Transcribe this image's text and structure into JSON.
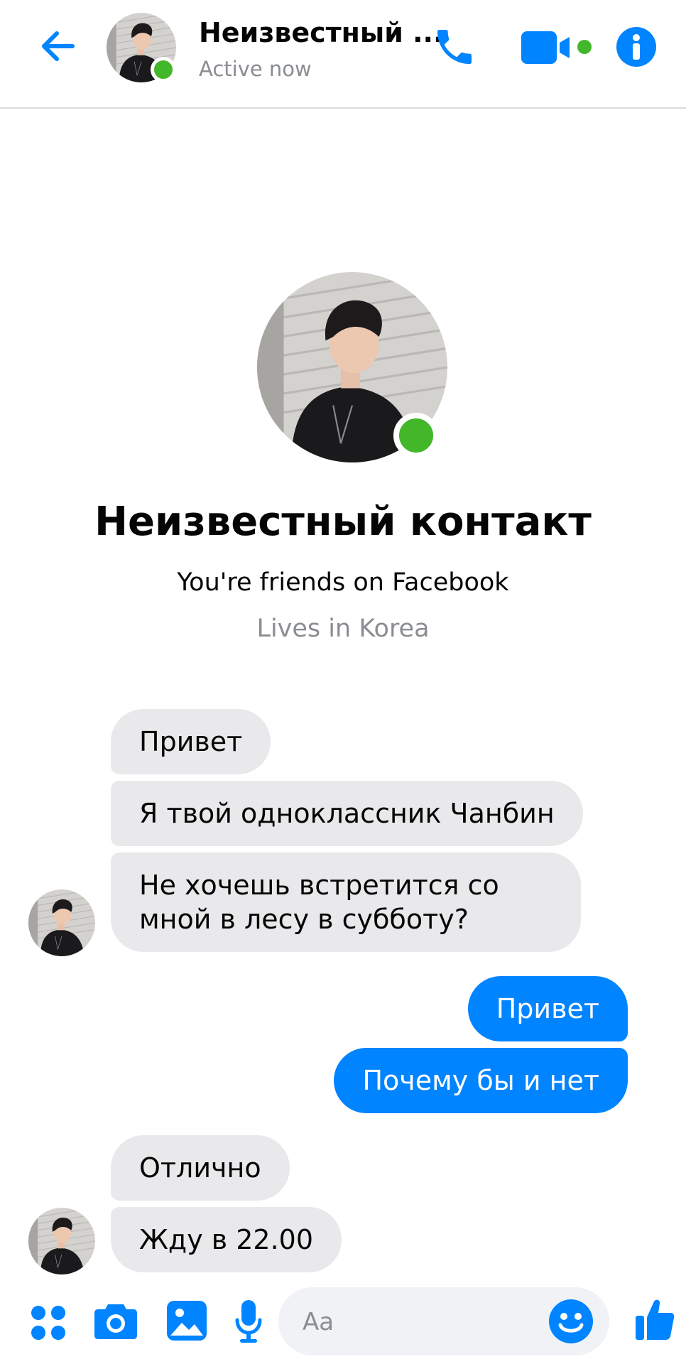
{
  "header": {
    "contact_name": "Неизвестный ...",
    "status": "Active now"
  },
  "profile": {
    "name": "Неизвестный контакт",
    "friendship": "You're friends on Facebook",
    "location": "Lives in Korea"
  },
  "messages": [
    {
      "from": "contact",
      "text": "Привет"
    },
    {
      "from": "contact",
      "text": "Я твой одноклассник Чанбин"
    },
    {
      "from": "contact",
      "text": "Не хочешь встретится со",
      "text2": "мной в лесу в субботу?"
    },
    {
      "from": "me",
      "text": "Привет"
    },
    {
      "from": "me",
      "text": "Почему бы и нет"
    },
    {
      "from": "contact",
      "text": "Отлично"
    },
    {
      "from": "contact",
      "text": "Жду в 22.00"
    }
  ],
  "composer": {
    "placeholder": "Aa"
  },
  "colors": {
    "accent": "#0084ff",
    "online": "#42b72a",
    "incoming_bubble": "#e9e9eb",
    "muted_text": "#8a8d91"
  },
  "icons": {
    "back": "arrow-left-icon",
    "call": "phone-icon",
    "video": "video-camera-icon",
    "info": "info-icon",
    "menu": "four-dots-icon",
    "camera": "camera-icon",
    "gallery": "image-icon",
    "voice": "microphone-icon",
    "emoji": "smiley-icon",
    "like": "thumbs-up-icon"
  }
}
